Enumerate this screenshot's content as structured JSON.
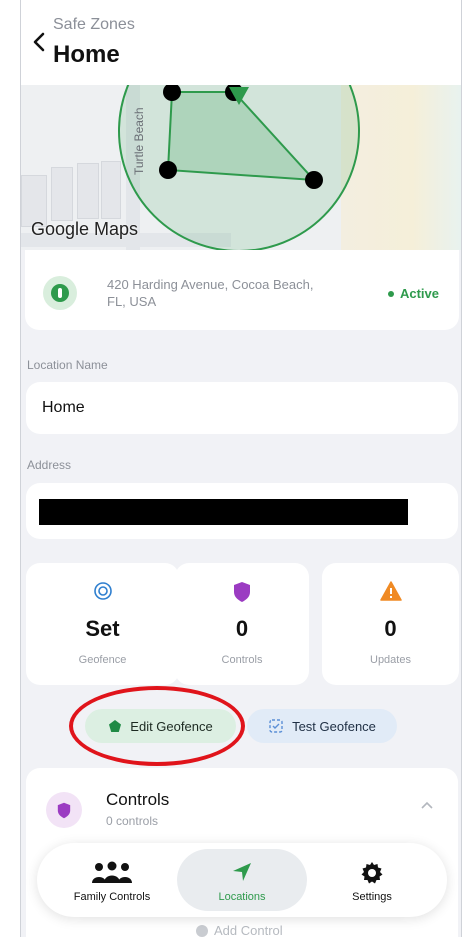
{
  "header": {
    "breadcrumb": "Safe Zones",
    "title": "Home"
  },
  "map": {
    "road_label": "Turtle Beach",
    "provider_logo": "Google Maps"
  },
  "address_card": {
    "address": "420 Harding Avenue, Cocoa Beach, FL, USA",
    "status": "Active",
    "status_color": "#2e9a4c"
  },
  "location_name": {
    "label": "Location Name",
    "value": "Home"
  },
  "address_field": {
    "label": "Address"
  },
  "stats": [
    {
      "icon": "geofence-target-icon",
      "value": "Set",
      "label": "Geofence"
    },
    {
      "icon": "shield-icon",
      "value": "0",
      "label": "Controls"
    },
    {
      "icon": "warning-icon",
      "value": "0",
      "label": "Updates"
    }
  ],
  "actions": {
    "edit_geofence": "Edit Geofence",
    "test_geofence": "Test Geofence"
  },
  "controls": {
    "title": "Controls",
    "subtitle": "0 controls",
    "add_label": "Add Control"
  },
  "tabbar": {
    "tabs": [
      {
        "label": "Family Controls",
        "icon": "family-icon"
      },
      {
        "label": "Locations",
        "icon": "location-arrow-icon",
        "active": true
      },
      {
        "label": "Settings",
        "icon": "gear-icon"
      }
    ]
  },
  "colors": {
    "accent_green": "#2e9a4c",
    "shield_purple": "#9b3bc2",
    "warning_orange": "#f08a24",
    "highlight_red": "#e0141b"
  }
}
